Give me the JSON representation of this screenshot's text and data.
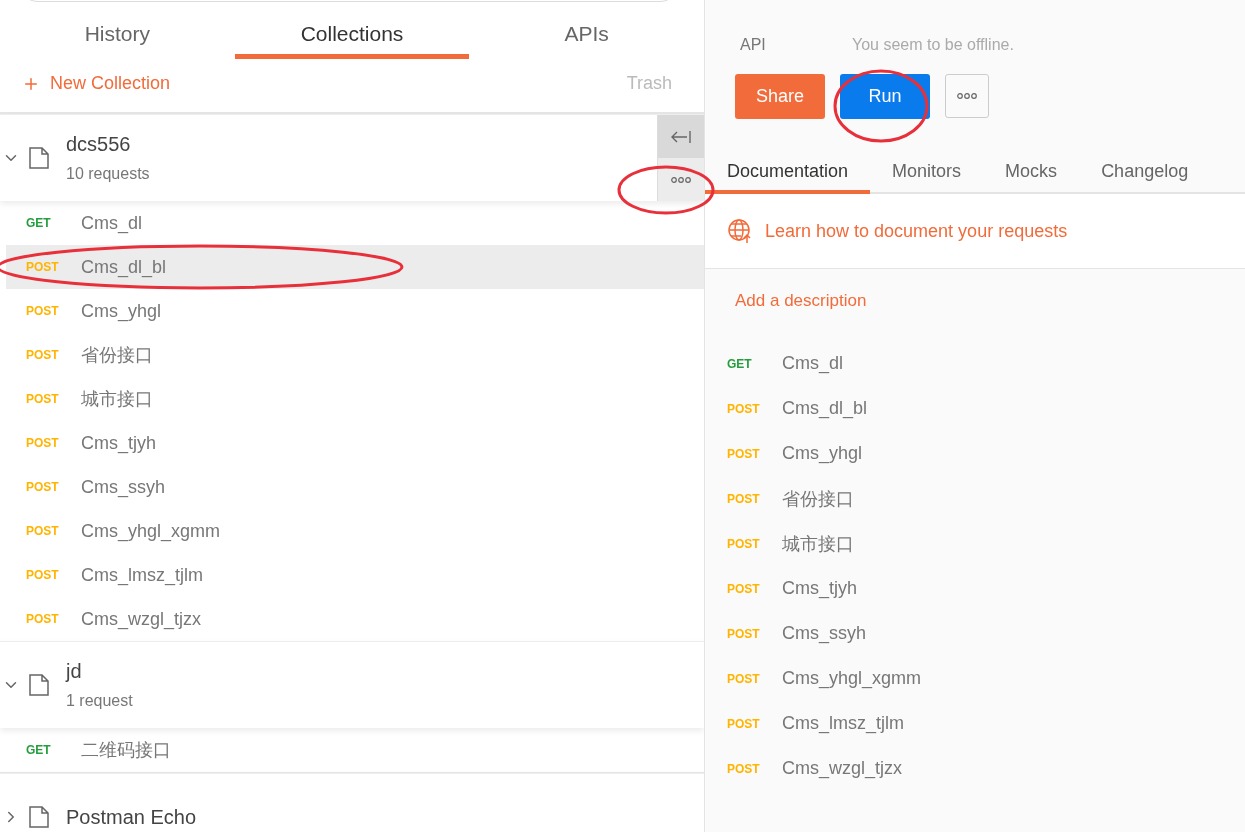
{
  "sidebar": {
    "tabs": [
      {
        "label": "History",
        "selected": false
      },
      {
        "label": "Collections",
        "selected": true
      },
      {
        "label": "APIs",
        "selected": false
      }
    ],
    "new_collection": "New Collection",
    "trash": "Trash",
    "collections": [
      {
        "name": "dcs556",
        "count": "10 requests",
        "expanded": true,
        "requests": [
          {
            "method": "GET",
            "color": "#249d3d",
            "name": "Cms_dl",
            "selected": false
          },
          {
            "method": "POST",
            "color": "#ffb400",
            "name": "Cms_dl_bl",
            "selected": true
          },
          {
            "method": "POST",
            "color": "#ffb400",
            "name": "Cms_yhgl",
            "selected": false
          },
          {
            "method": "POST",
            "color": "#ffb400",
            "name": "省份接口",
            "selected": false
          },
          {
            "method": "POST",
            "color": "#ffb400",
            "name": "城市接口",
            "selected": false
          },
          {
            "method": "POST",
            "color": "#ffb400",
            "name": "Cms_tjyh",
            "selected": false
          },
          {
            "method": "POST",
            "color": "#ffb400",
            "name": "Cms_ssyh",
            "selected": false
          },
          {
            "method": "POST",
            "color": "#ffb400",
            "name": "Cms_yhgl_xgmm",
            "selected": false
          },
          {
            "method": "POST",
            "color": "#ffb400",
            "name": "Cms_lmsz_tjlm",
            "selected": false
          },
          {
            "method": "POST",
            "color": "#ffb400",
            "name": "Cms_wzgl_tjzx",
            "selected": false
          }
        ]
      },
      {
        "name": "jd",
        "count": "1 request",
        "expanded": true,
        "requests": [
          {
            "method": "GET",
            "color": "#249d3d",
            "name": "二维码接口",
            "selected": false
          }
        ]
      },
      {
        "name": "Postman Echo",
        "expanded": false
      }
    ]
  },
  "detail": {
    "api_label": "API",
    "status": "You seem to be offline.",
    "buttons": {
      "share": "Share",
      "run": "Run"
    },
    "tabs": [
      {
        "label": "Documentation",
        "selected": true
      },
      {
        "label": "Monitors",
        "selected": false
      },
      {
        "label": "Mocks",
        "selected": false
      },
      {
        "label": "Changelog",
        "selected": false
      }
    ],
    "learn_link": "Learn how to document your requests",
    "add_description": "Add a description",
    "requests": [
      {
        "method": "GET",
        "color": "#249d3d",
        "name": "Cms_dl"
      },
      {
        "method": "POST",
        "color": "#ffb400",
        "name": "Cms_dl_bl"
      },
      {
        "method": "POST",
        "color": "#ffb400",
        "name": "Cms_yhgl"
      },
      {
        "method": "POST",
        "color": "#ffb400",
        "name": "省份接口"
      },
      {
        "method": "POST",
        "color": "#ffb400",
        "name": "城市接口"
      },
      {
        "method": "POST",
        "color": "#ffb400",
        "name": "Cms_tjyh"
      },
      {
        "method": "POST",
        "color": "#ffb400",
        "name": "Cms_ssyh"
      },
      {
        "method": "POST",
        "color": "#ffb400",
        "name": "Cms_yhgl_xgmm"
      },
      {
        "method": "POST",
        "color": "#ffb400",
        "name": "Cms_lmsz_tjlm"
      },
      {
        "method": "POST",
        "color": "#ffb400",
        "name": "Cms_wzgl_tjzx"
      }
    ]
  }
}
